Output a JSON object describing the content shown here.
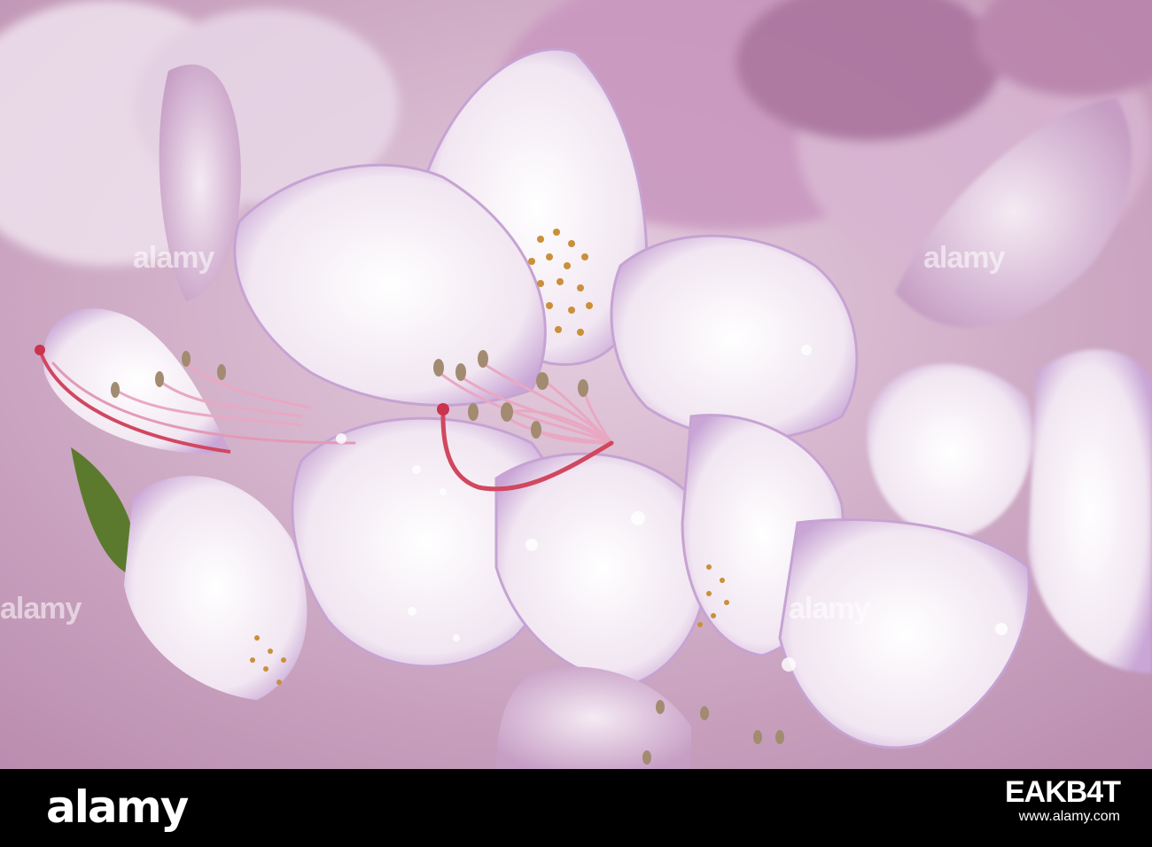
{
  "photo": {
    "subject": "pale pink rhododendron flowers with water droplets",
    "colors": {
      "petal": "#f2e6f1",
      "petal_edge": "#c6a3d3",
      "spots": "#c98f3a",
      "stamen": "#e9a8c2",
      "pistil": "#d1475f",
      "leaf": "#5b7a2e"
    }
  },
  "watermark": {
    "text": "alamy"
  },
  "footer": {
    "brand": "alamy",
    "code": "EAKB4T",
    "url": "www.alamy.com"
  }
}
